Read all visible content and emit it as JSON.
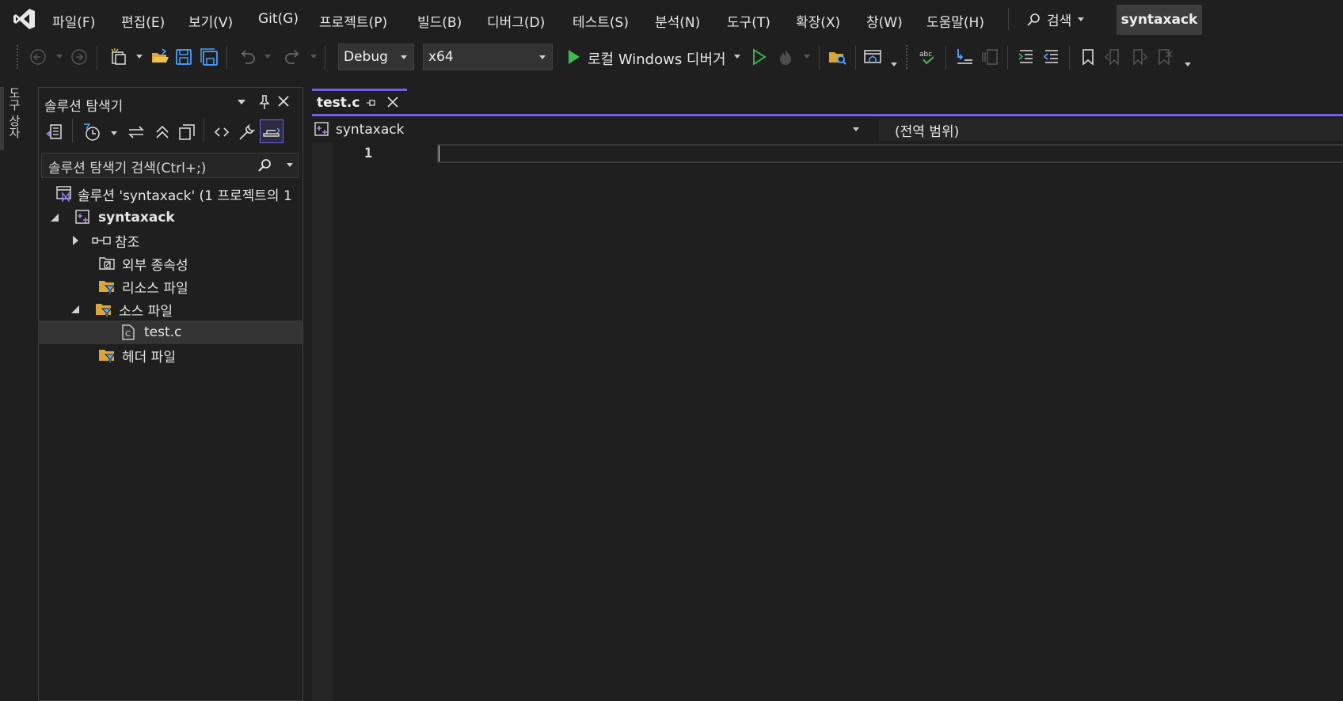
{
  "menubar": {
    "items": [
      {
        "label": "파일(F)",
        "key": "file"
      },
      {
        "label": "편집(E)",
        "key": "edit"
      },
      {
        "label": "보기(V)",
        "key": "view"
      },
      {
        "label": "Git(G)",
        "key": "git"
      },
      {
        "label": "프로젝트(P)",
        "key": "project"
      },
      {
        "label": "빌드(B)",
        "key": "build"
      },
      {
        "label": "디버그(D)",
        "key": "debug"
      },
      {
        "label": "테스트(S)",
        "key": "test"
      },
      {
        "label": "분석(N)",
        "key": "analyze"
      },
      {
        "label": "도구(T)",
        "key": "tools"
      },
      {
        "label": "확장(X)",
        "key": "extensions"
      },
      {
        "label": "창(W)",
        "key": "window"
      },
      {
        "label": "도움말(H)",
        "key": "help"
      }
    ],
    "search_label": "검색",
    "solution_name": "syntaxack"
  },
  "toolbar": {
    "configuration": "Debug",
    "platform": "x64",
    "run_target": "로컬 Windows 디버거",
    "run_color": "#3fb950"
  },
  "left_strip": {
    "tab_label": "도구 상자"
  },
  "solution_explorer": {
    "title": "솔루션 탐색기",
    "search_placeholder": "솔루션 탐색기 검색(Ctrl+;)",
    "tree": {
      "solution": "솔루션 'syntaxack' (1 프로젝트의 1",
      "project": "syntaxack",
      "references": "참조",
      "external_deps": "외부 종속성",
      "resource_files": "리소스 파일",
      "source_files": "소스 파일",
      "source_file_1": "test.c",
      "header_files": "헤더 파일"
    }
  },
  "editor": {
    "active_tab": "test.c",
    "nav_project": "syntaxack",
    "nav_scope": "(전역 범위)",
    "line_numbers": [
      "1"
    ],
    "accent": "#7160e8"
  }
}
